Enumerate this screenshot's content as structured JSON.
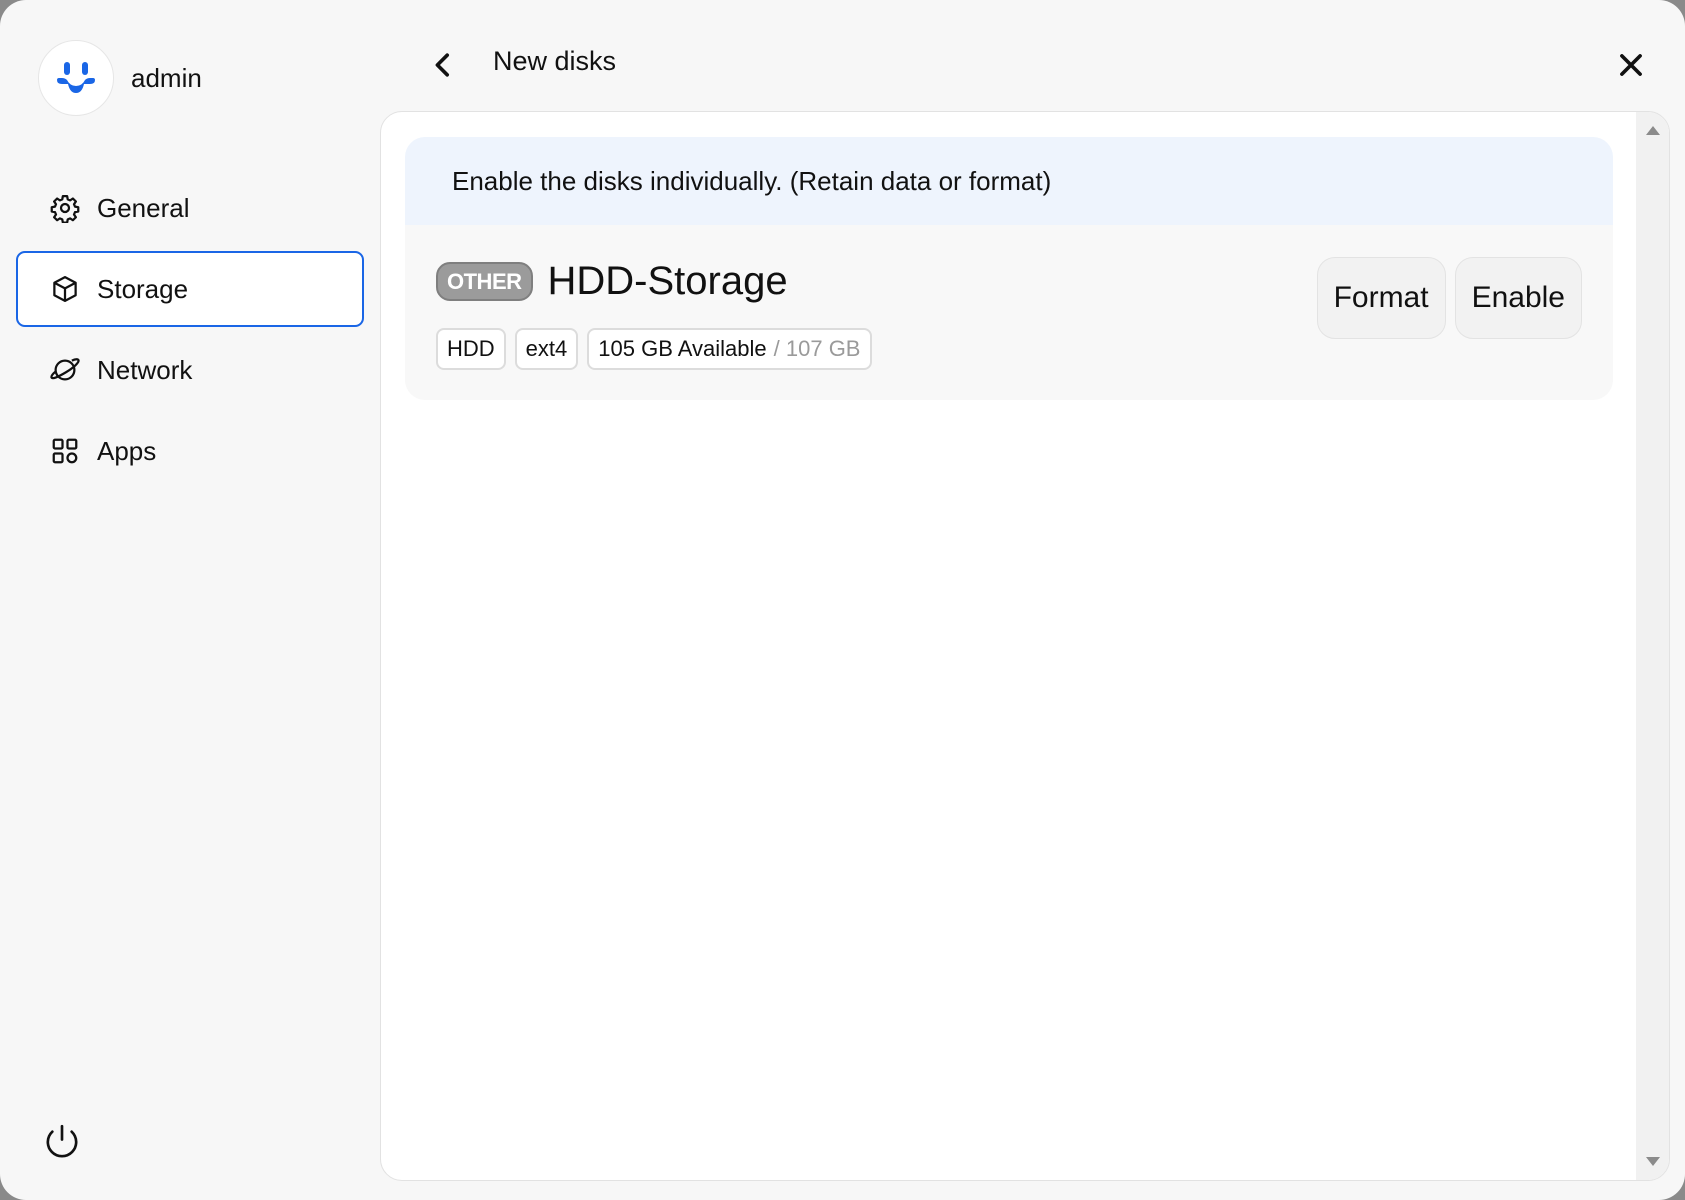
{
  "user": {
    "name": "admin"
  },
  "sidebar": {
    "items": [
      {
        "label": "General",
        "icon": "gear-icon"
      },
      {
        "label": "Storage",
        "icon": "box-icon",
        "active": true
      },
      {
        "label": "Network",
        "icon": "planet-icon"
      },
      {
        "label": "Apps",
        "icon": "grid-icon"
      }
    ]
  },
  "header": {
    "title": "New disks"
  },
  "notice": {
    "text": "Enable the disks individually. (Retain data or format)"
  },
  "disk": {
    "badge": "OTHER",
    "name": "HDD-Storage",
    "tags": {
      "type": "HDD",
      "filesystem": "ext4",
      "available": "105 GB Available",
      "total": "/ 107 GB"
    },
    "actions": {
      "format": "Format",
      "enable": "Enable"
    }
  },
  "colors": {
    "accent": "#1a66e6",
    "notice_bg": "#eef4fd",
    "badge_bg": "#9b9b9b"
  }
}
